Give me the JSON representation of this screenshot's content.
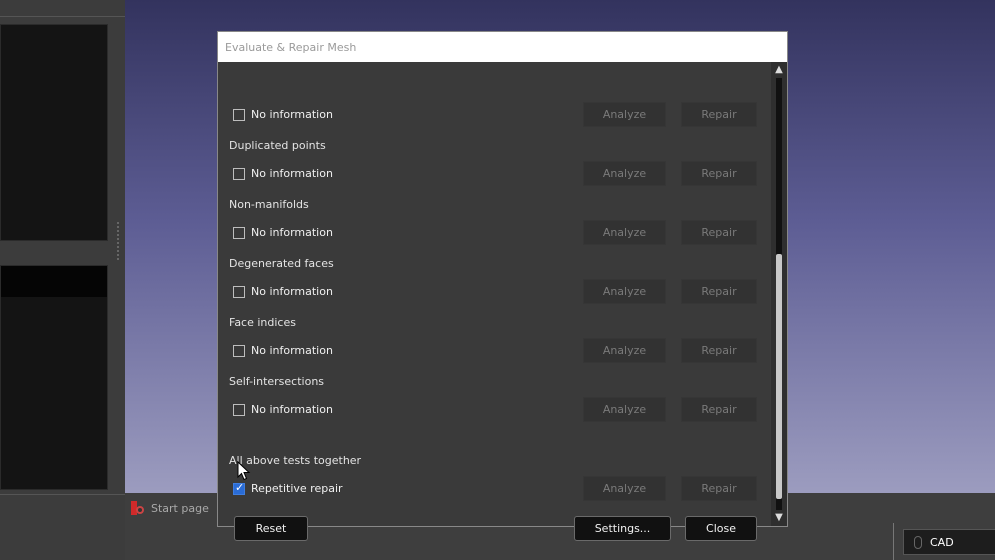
{
  "dialog": {
    "title": "Evaluate & Repair Mesh",
    "rows": [
      {
        "section": "",
        "label": "No information",
        "checked": false,
        "analyze": "Analyze",
        "repair": "Repair"
      },
      {
        "section": "Duplicated points",
        "label": "No information",
        "checked": false,
        "analyze": "Analyze",
        "repair": "Repair"
      },
      {
        "section": "Non-manifolds",
        "label": "No information",
        "checked": false,
        "analyze": "Analyze",
        "repair": "Repair"
      },
      {
        "section": "Degenerated faces",
        "label": "No information",
        "checked": false,
        "analyze": "Analyze",
        "repair": "Repair"
      },
      {
        "section": "Face indices",
        "label": "No information",
        "checked": false,
        "analyze": "Analyze",
        "repair": "Repair"
      },
      {
        "section": "Self-intersections",
        "label": "No information",
        "checked": false,
        "analyze": "Analyze",
        "repair": "Repair"
      }
    ],
    "all_tests": {
      "section": "All above tests together",
      "label": "Repetitive repair",
      "checked": true,
      "analyze": "Analyze",
      "repair": "Repair"
    },
    "buttons": {
      "reset": "Reset",
      "settings": "Settings...",
      "close": "Close"
    }
  },
  "tabs": {
    "start_page": "Start page"
  },
  "status": {
    "workbench": "CAD"
  },
  "icons": {
    "checkbox": "checkbox-icon",
    "scroll_up": "chevron-up-icon",
    "scroll_down": "chevron-down-icon",
    "start_page": "freecad-logo-icon",
    "mouse": "mouse-icon",
    "cursor": "mouse-pointer-icon"
  },
  "colors": {
    "accent": "#2a6cd6",
    "dialog_bg": "#3a3a3a",
    "viewport_top": "#33335e",
    "viewport_bottom": "#9c9cbf"
  }
}
